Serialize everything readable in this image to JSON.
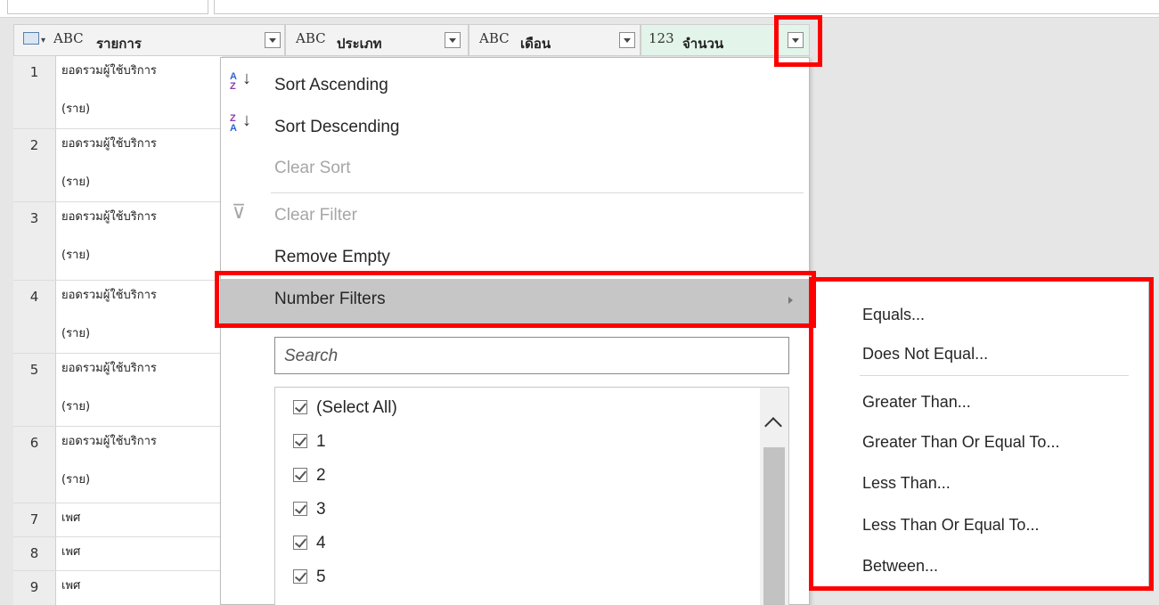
{
  "columns": [
    {
      "type_icon": "ABC",
      "title": "รายการ"
    },
    {
      "type_icon": "ABC",
      "title": "ประเภท"
    },
    {
      "type_icon": "ABC",
      "title": "เดือน"
    },
    {
      "type_icon": "123",
      "title": "จำนวน"
    }
  ],
  "rows": [
    {
      "n": "1",
      "line1": "ยอดรวมผู้ใช้บริการ",
      "line2": "(ราย)"
    },
    {
      "n": "2",
      "line1": "ยอดรวมผู้ใช้บริการ",
      "line2": "(ราย)"
    },
    {
      "n": "3",
      "line1": "ยอดรวมผู้ใช้บริการ",
      "line2": "(ราย)"
    },
    {
      "n": "4",
      "line1": "ยอดรวมผู้ใช้บริการ",
      "line2": "(ราย)"
    },
    {
      "n": "5",
      "line1": "ยอดรวมผู้ใช้บริการ",
      "line2": "(ราย)"
    },
    {
      "n": "6",
      "line1": "ยอดรวมผู้ใช้บริการ",
      "line2": "(ราย)"
    },
    {
      "n": "7",
      "line1": "เพศ"
    },
    {
      "n": "8",
      "line1": "เพศ"
    },
    {
      "n": "9",
      "line1": "เพศ"
    }
  ],
  "menu": {
    "sort_asc": "Sort Ascending",
    "sort_desc": "Sort Descending",
    "clear_sort": "Clear Sort",
    "clear_filter": "Clear Filter",
    "remove_empty": "Remove Empty",
    "number_filters": "Number Filters",
    "search_placeholder": "Search",
    "values": [
      "(Select All)",
      "1",
      "2",
      "3",
      "4",
      "5"
    ]
  },
  "submenu": {
    "items": [
      "Equals...",
      "Does Not Equal...",
      "Greater Than...",
      "Greater Than Or Equal To...",
      "Less Than...",
      "Less Than Or Equal To...",
      "Between..."
    ]
  },
  "colors": {
    "highlight": "#c6c6c6",
    "annotation": "#ff0000",
    "number_header": "#e3f4ea"
  }
}
